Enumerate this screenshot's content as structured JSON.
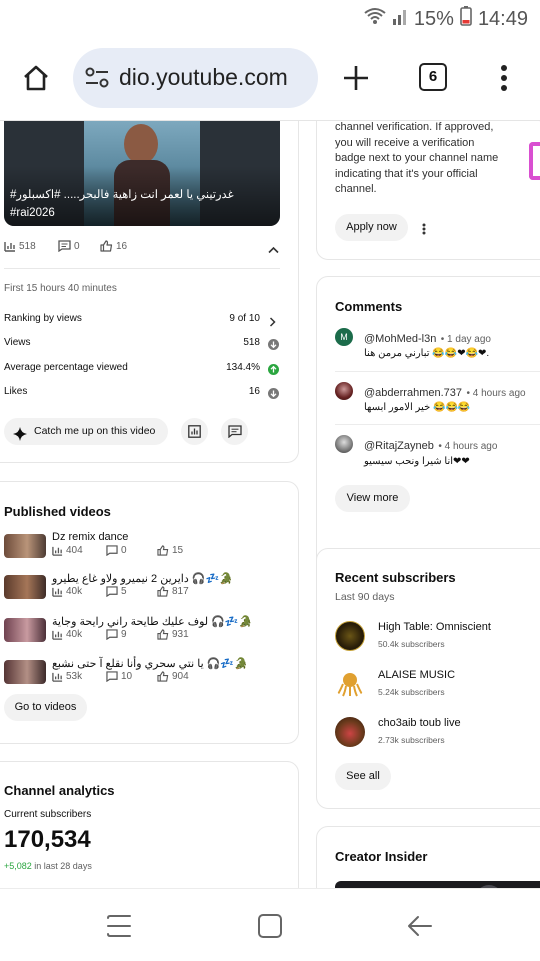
{
  "status": {
    "battery": "15%",
    "time": "14:49"
  },
  "browser": {
    "url": "dio.youtube.com",
    "tab_count": "6"
  },
  "video": {
    "caption_line1": "غدرتيني يا لعمر انت زاهية فالبحر..... #اكسبلور#",
    "caption_line2": "#rai2026",
    "views": "518",
    "comments": "0",
    "likes": "16",
    "age": "First 15 hours 40 minutes",
    "stats": [
      {
        "label": "Ranking by views",
        "value": "9 of 10"
      },
      {
        "label": "Views",
        "value": "518"
      },
      {
        "label": "Average percentage viewed",
        "value": "134.4%"
      },
      {
        "label": "Likes",
        "value": "16"
      }
    ],
    "catch_up_label": "Catch me up on this video"
  },
  "published": {
    "title": "Published videos",
    "items": [
      {
        "title": "Dz remix dance",
        "views": "404",
        "comments": "0",
        "likes": "15"
      },
      {
        "title": "دايرين 2 نيميرو ولاو غاع يطيرو 🎧💤🐊",
        "views": "40k",
        "comments": "5",
        "likes": "817"
      },
      {
        "title": "لوف عليك طايحة راني رايحة وجاية 🎧💤🐊",
        "views": "40k",
        "comments": "9",
        "likes": "931"
      },
      {
        "title": "يا نتي سحري وأنا نقلع آ حتى نشبع 🎧💤🐊",
        "views": "53k",
        "comments": "10",
        "likes": "904"
      }
    ],
    "button": "Go to videos"
  },
  "analytics": {
    "title": "Channel analytics",
    "subs_label": "Current subscribers",
    "subs_value": "170,534",
    "change": "+5,082",
    "change_suffix": " in last 28 days"
  },
  "verification": {
    "line1": "channel verification. If approved,",
    "line2": "you will receive a verification",
    "line3": "badge next to your channel name",
    "line4": "indicating that it's your official",
    "line5": "channel.",
    "button": "Apply now"
  },
  "comments": {
    "title": "Comments",
    "items": [
      {
        "initial": "M",
        "author": "@MohMed-l3n",
        "time": "• 1 day ago",
        "text": "تبارني مرمن هنا 😂😂❤😂❤."
      },
      {
        "initial": "",
        "author": "@abderrahmen.737",
        "time": "• 4 hours ago",
        "text": "خير الامور ابسها 😂😂😂"
      },
      {
        "initial": "",
        "author": "@RitajZayneb",
        "time": "• 4 hours ago",
        "text": "انا شيرا ونحب سيسيو❤❤"
      }
    ],
    "button": "View more"
  },
  "subscribers": {
    "title": "Recent subscribers",
    "period": "Last 90 days",
    "items": [
      {
        "name": "High Table: Omniscient",
        "count": "50.4k subscribers"
      },
      {
        "name": "ALAISE MUSIC",
        "count": "5.24k subscribers"
      },
      {
        "name": "cho3aib toub live",
        "count": "2.73k subscribers"
      }
    ],
    "button": "See all"
  },
  "creator": {
    "title": "Creator Insider"
  },
  "colors": {
    "accent": "#065fd4",
    "green": "#2ba640",
    "pill": "#f2f2f2",
    "urlbar": "#e7ecf6"
  }
}
